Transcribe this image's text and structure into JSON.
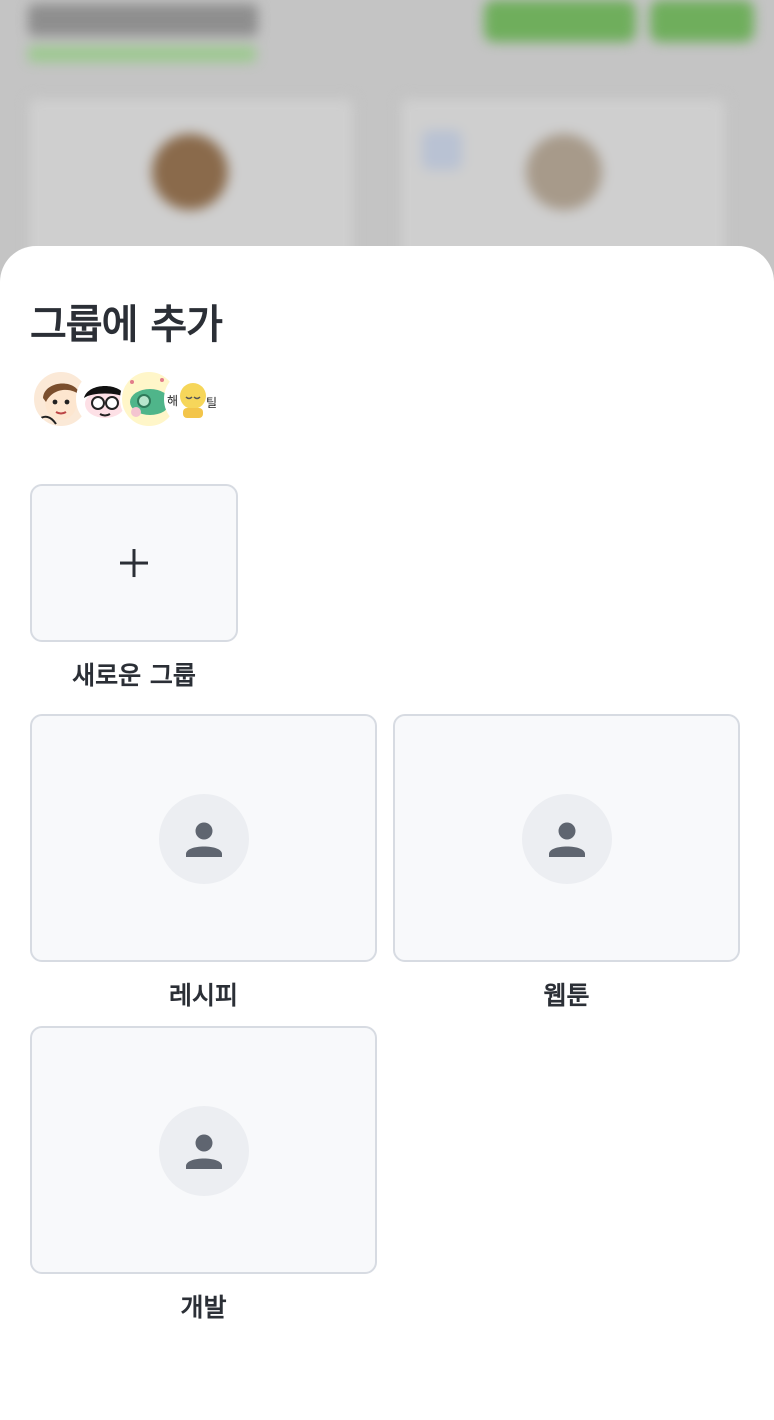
{
  "sheet": {
    "title": "그룹에 추가"
  },
  "members": {
    "avatars": [
      "avatar-1",
      "avatar-2",
      "avatar-3",
      "avatar-4"
    ],
    "avatar4_text_a": "해",
    "avatar4_text_b": "틸"
  },
  "new_group": {
    "icon": "plus-icon",
    "label": "새로운 그룹"
  },
  "groups": [
    {
      "label": "레시피",
      "icon": "person-icon"
    },
    {
      "label": "웹툰",
      "icon": "person-icon"
    },
    {
      "label": "개발",
      "icon": "person-icon"
    }
  ],
  "colors": {
    "text": "#2b2f36",
    "tile_bg": "#f8f9fb",
    "tile_border": "#d7dbe2",
    "icon": "#5f6570",
    "accent_bg": "#6fae5c"
  }
}
